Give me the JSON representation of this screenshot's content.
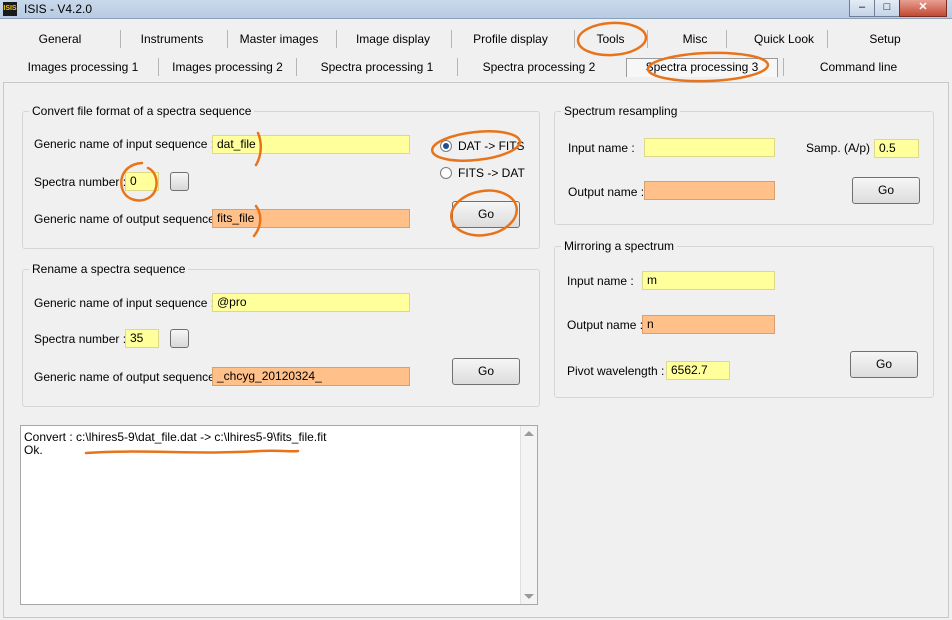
{
  "window": {
    "title": "ISIS - V4.2.0",
    "icon_text": "ISIS",
    "minimize_glyph": "–",
    "maximize_glyph": "□",
    "close_glyph": "✕"
  },
  "tabs_row1": [
    "General",
    "Instruments",
    "Master images",
    "Image display",
    "Profile display",
    "Tools",
    "Misc",
    "Quick Look",
    "Setup"
  ],
  "tabs_row2": [
    "Images processing  1",
    "Images processing 2",
    "Spectra processing 1",
    "Spectra processing 2",
    "Spectra processing 3",
    "Command line"
  ],
  "active_tab": "Spectra processing 3",
  "convert": {
    "title": "Convert file format of a spectra sequence",
    "input_label": "Generic name of input sequence :",
    "input_value": "dat_file",
    "number_label": "Spectra number :",
    "number_value": "0",
    "output_label": "Generic name of output sequence :",
    "output_value": "fits_file",
    "radio1": "DAT -> FITS",
    "radio2": "FITS -> DAT",
    "go": "Go"
  },
  "rename": {
    "title": "Rename a spectra sequence",
    "input_label": "Generic name of input sequence :",
    "input_value": "@pro",
    "number_label": "Spectra number :",
    "number_value": "35",
    "output_label": "Generic name of output sequence :",
    "output_value": "_chcyg_20120324_",
    "go": "Go"
  },
  "resampling": {
    "title": "Spectrum resampling",
    "input_label": "Input name :",
    "input_value": "",
    "samp_label": "Samp. (A/p) :",
    "samp_value": "0.5",
    "output_label": "Output name :",
    "output_value": "",
    "go": "Go"
  },
  "mirroring": {
    "title": "Mirroring a spectrum",
    "input_label": "Input name :",
    "input_value": "m",
    "output_label": "Output name :",
    "output_value": "n",
    "pivot_label": "Pivot wavelength :",
    "pivot_value": "6562.7",
    "go": "Go"
  },
  "log": {
    "line1": "Convert : c:\\lhires5-9\\dat_file.dat -> c:\\lhires5-9\\fits_file.fit",
    "line2": "Ok."
  },
  "annotation_color": "#e8731a"
}
